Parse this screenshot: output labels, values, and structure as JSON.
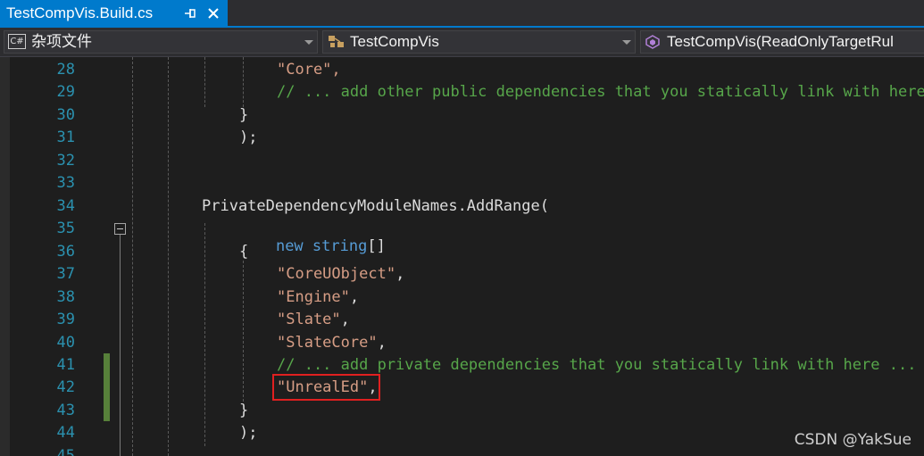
{
  "tab": {
    "title": "TestCompVis.Build.cs"
  },
  "navbar": {
    "project": "杂项文件",
    "type": "TestCompVis",
    "member": "TestCompVis(ReadOnlyTargetRul",
    "project_icon": "C#"
  },
  "editor": {
    "line_numbers": [
      "28",
      "29",
      "30",
      "31",
      "32",
      "33",
      "34",
      "35",
      "36",
      "37",
      "38",
      "39",
      "40",
      "41",
      "42",
      "43",
      "44",
      "45"
    ],
    "lines": {
      "l28": "\"Core\",",
      "l29": "// ... add other public dependencies that you statically link with here",
      "l30": "}",
      "l31": ");",
      "l34": "PrivateDependencyModuleNames.AddRange(",
      "l35_kw1": "new",
      "l35_kw2": "string",
      "l35_rest": "[]",
      "l36": "{",
      "l37_str": "\"CoreUObject\"",
      "l37_punct": ",",
      "l38_str": "\"Engine\"",
      "l38_punct": ",",
      "l39_str": "\"Slate\"",
      "l39_punct": ",",
      "l40_str": "\"SlateCore\"",
      "l40_punct": ",",
      "l41": "// ... add private dependencies that you statically link with here ...",
      "l42_str": "\"UnrealEd\"",
      "l42_punct": ",",
      "l43": "}",
      "l44": ");"
    }
  },
  "watermark": "CSDN @YakSue",
  "colors": {
    "accent": "#007acc",
    "string": "#d69d85",
    "comment": "#57a64a",
    "keyword": "#569cd6",
    "line_number": "#2b91af",
    "highlight_box": "#e02020",
    "change_bar": "#57803a"
  }
}
